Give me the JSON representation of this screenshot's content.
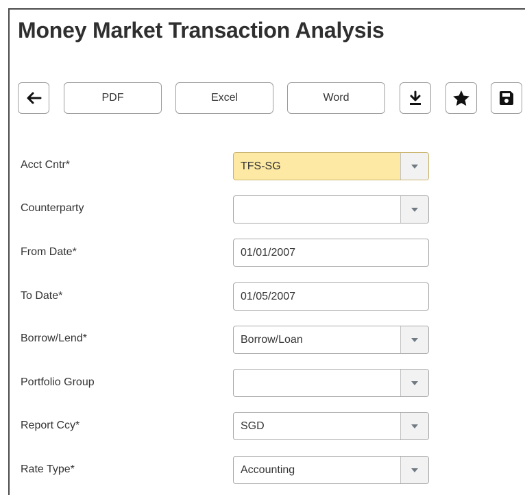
{
  "page": {
    "title": "Money Market Transaction Analysis"
  },
  "toolbar": {
    "back_icon": "arrow-left-icon",
    "pdf_label": "PDF",
    "excel_label": "Excel",
    "word_label": "Word",
    "download_icon": "download-icon",
    "favorite_icon": "star-icon",
    "save_icon": "floppy-disk-icon"
  },
  "form": {
    "acct_cntr": {
      "label": "Acct Cntr*",
      "value": "TFS-SG"
    },
    "counterparty": {
      "label": "Counterparty",
      "value": ""
    },
    "from_date": {
      "label": "From Date*",
      "value": "01/01/2007"
    },
    "to_date": {
      "label": "To Date*",
      "value": "01/05/2007"
    },
    "borrow_lend": {
      "label": "Borrow/Lend*",
      "value": "Borrow/Loan"
    },
    "portfolio_group": {
      "label": "Portfolio Group",
      "value": ""
    },
    "report_ccy": {
      "label": "Report Ccy*",
      "value": "SGD"
    },
    "rate_type": {
      "label": "Rate Type*",
      "value": "Accounting"
    }
  },
  "colors": {
    "highlight_field": "#fde9a3",
    "border": "#a8a8a8",
    "text": "#333333"
  }
}
